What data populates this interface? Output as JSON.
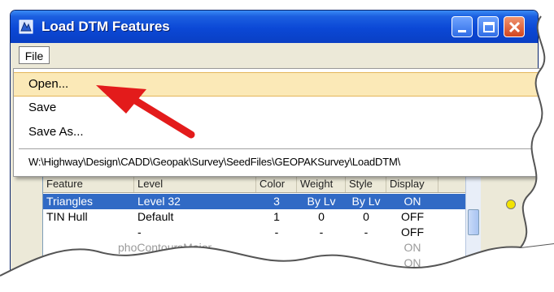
{
  "window": {
    "title": "Load DTM Features"
  },
  "menubar": {
    "file_label": "File"
  },
  "file_menu": {
    "items": [
      "Open...",
      "Save",
      "Save As..."
    ],
    "recent_path": "W:\\Highway\\Design\\CADD\\Geopak\\Survey\\SeedFiles\\GEOPAKSurvey\\LoadDTM\\"
  },
  "table": {
    "columns": [
      "Feature",
      "Level",
      "Color",
      "Weight",
      "Style",
      "Display"
    ],
    "rows": [
      [
        "Triangles",
        "Level 32",
        "3",
        "By Lv",
        "By Lv",
        "ON"
      ],
      [
        "TIN Hull",
        "Default",
        "1",
        "0",
        "0",
        "OFF"
      ],
      [
        "-",
        "-",
        "-",
        "-",
        "-",
        "OFF"
      ],
      [
        "phoContoursMajor",
        "",
        "",
        "",
        "",
        "ON"
      ],
      [
        "oContoursM",
        "",
        "",
        "",
        "",
        "ON"
      ]
    ]
  },
  "colors": {
    "title_bar": "#0b48d6",
    "highlight": "#fbe9b7",
    "selection": "#316ac5",
    "arrow": "#e31b1b"
  }
}
